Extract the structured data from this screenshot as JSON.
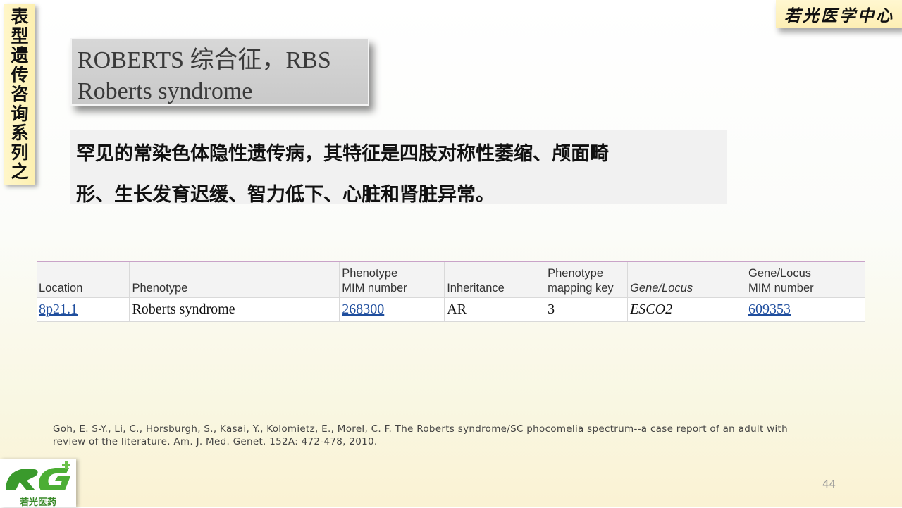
{
  "side_tab": {
    "chars": [
      "表",
      "型",
      "遗",
      "传",
      "咨",
      "询",
      "系",
      "列",
      "之"
    ]
  },
  "brand": {
    "text": "若光医学中心"
  },
  "title": {
    "line1": "ROBERTS 综合征，RBS",
    "line2": "Roberts syndrome"
  },
  "description": {
    "line1": "罕见的常染色体隐性遗传病，其特征是四肢对称性萎缩、颅面畸",
    "line2": "形、生长发育迟缓、智力低下、心脏和肾脏异常。"
  },
  "table": {
    "headers": {
      "location": "Location",
      "phenotype": "Phenotype",
      "phenotype_mim_1": "Phenotype",
      "phenotype_mim_2": "MIM number",
      "inheritance": "Inheritance",
      "mapping_key_1": "Phenotype",
      "mapping_key_2": "mapping key",
      "gene_locus": "Gene/Locus",
      "gene_mim_1": "Gene/Locus",
      "gene_mim_2": "MIM number"
    },
    "row": {
      "location": "8p21.1",
      "phenotype": "Roberts syndrome",
      "phenotype_mim": "268300",
      "inheritance": "AR",
      "mapping_key": "3",
      "gene_locus": "ESCO2",
      "gene_mim": "609353"
    }
  },
  "reference": {
    "line1": "Goh, E. S-Y., Li, C., Horsburgh, S., Kasai, Y., Kolomietz, E., Morel, C. F. The Roberts syndrome/SC phocomelia spectrum--a case report of an adult with",
    "line2": "review of the literature. Am. J. Med. Genet. 152A: 472-478, 2010."
  },
  "page_number": "44",
  "logo": {
    "text": "若光医药"
  },
  "colors": {
    "link": "#1f4e9e",
    "logo_green": "#3a8a2a",
    "tab_yellow": "#fdf0b0"
  }
}
